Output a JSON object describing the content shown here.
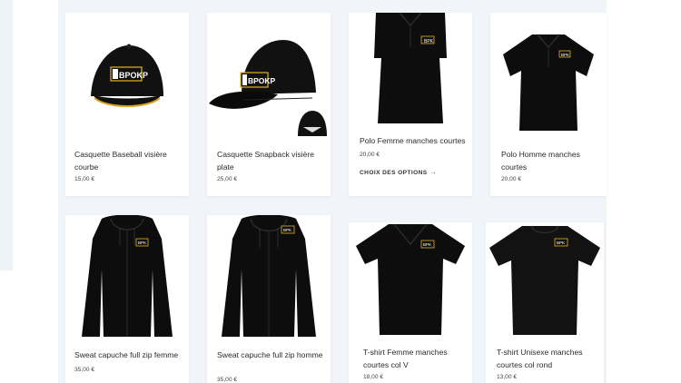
{
  "colors": {
    "page_background": "#f1f5f9",
    "card_background": "#ffffff",
    "product_black": "#0d0d0d",
    "logo_yellow": "#e3b223"
  },
  "products": [
    {
      "title": "Casquette Baseball visière courbe",
      "price": "15,00 €",
      "image": "baseball-cap-image"
    },
    {
      "title": "Casquette Snapback visière plate",
      "price": "25,00 €",
      "image": "snapback-cap-image"
    },
    {
      "title": "Polo Femme manches courtes",
      "price": "20,00 €",
      "image": "polo-women-image",
      "action": "Choix des options",
      "action_icon": "arrow-right-icon"
    },
    {
      "title": "Polo Homme manches courtes",
      "price": "20,00 €",
      "image": "polo-men-image"
    },
    {
      "title": "Sweat capuche full zip femme",
      "price": "35,00 €",
      "image": "hoodie-women-image"
    },
    {
      "title": "Sweat capuche full zip homme",
      "price": "35,00 €",
      "image": "hoodie-men-image"
    },
    {
      "title": "T-shirt Femme manches courtes col V",
      "price": "18,00 €",
      "image": "tshirt-women-image"
    },
    {
      "title": "T-shirt Unisexe manches courtes col rond",
      "price": "13,00 €",
      "image": "tshirt-unisex-image"
    }
  ],
  "logo_text": "BPOKP",
  "logo_text_small": "BPK"
}
